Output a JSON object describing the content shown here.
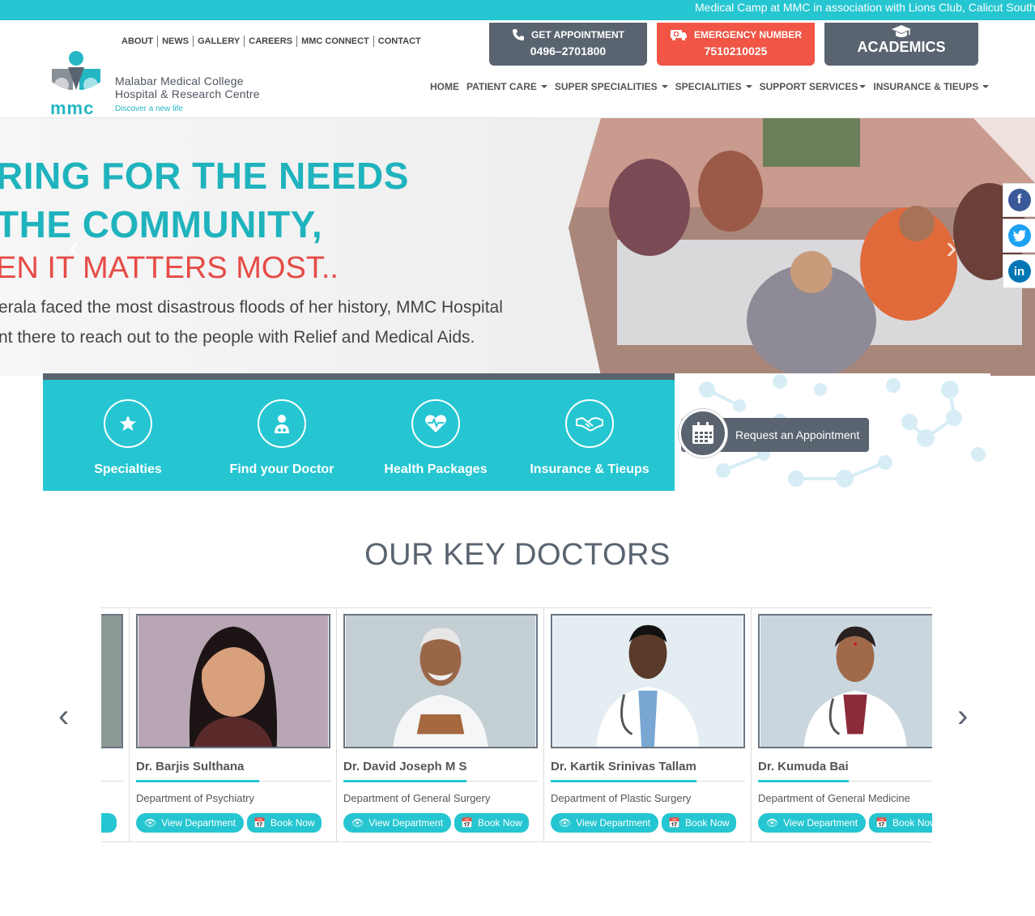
{
  "ticker": {
    "text": "Medical Camp at MMC in association with Lions Club, Calicut South"
  },
  "toplinks": [
    "ABOUT",
    "NEWS",
    "GALLERY",
    "CAREERS",
    "MMC CONNECT",
    "CONTACT"
  ],
  "logo": {
    "line1": "Malabar Medical College",
    "line2": "Hospital & Research Centre",
    "tagline": "Discover a new life",
    "mark": "mmc"
  },
  "cta": {
    "appointment_label": "GET APPOINTMENT",
    "appointment_number": "0496–2701800",
    "emergency_label": "EMERGENCY NUMBER",
    "emergency_number": "7510210025",
    "academics_label": "ACADEMICS"
  },
  "mainnav": [
    "HOME",
    "PATIENT CARE",
    "SUPER SPECIALITIES",
    "SPECIALITIES",
    "SUPPORT SERVICES",
    "INSURANCE & TIEUPS"
  ],
  "hero": {
    "line1": "RING FOR THE NEEDS",
    "line2": "THE COMMUNITY,",
    "line3": "EN IT MATTERS MOST..",
    "para1": "erala faced the most disastrous floods of her history, MMC Hospital",
    "para2": "nt there to reach out to the people with Relief and Medical Aids."
  },
  "quicklinks": [
    "Specialties",
    "Find your Doctor",
    "Health Packages",
    "Insurance & Tieups"
  ],
  "appointment_button": "Request an Appointment",
  "section_title": "OUR KEY DOCTORS",
  "doctors": [
    {
      "name": "Dr. Barjis Sulthana",
      "dept": "Department of Psychiatry"
    },
    {
      "name": "Dr. David Joseph M S",
      "dept": "Department of General Surgery"
    },
    {
      "name": "Dr. Kartik Srinivas Tallam",
      "dept": "Department of Plastic Surgery"
    },
    {
      "name": "Dr. Kumuda Bai",
      "dept": "Department of General Medicine"
    }
  ],
  "card_buttons": {
    "view": "View Department",
    "book": "Book Now"
  },
  "colors": {
    "teal": "#25c6d1",
    "slate": "#5a6470",
    "red": "#f05545"
  }
}
